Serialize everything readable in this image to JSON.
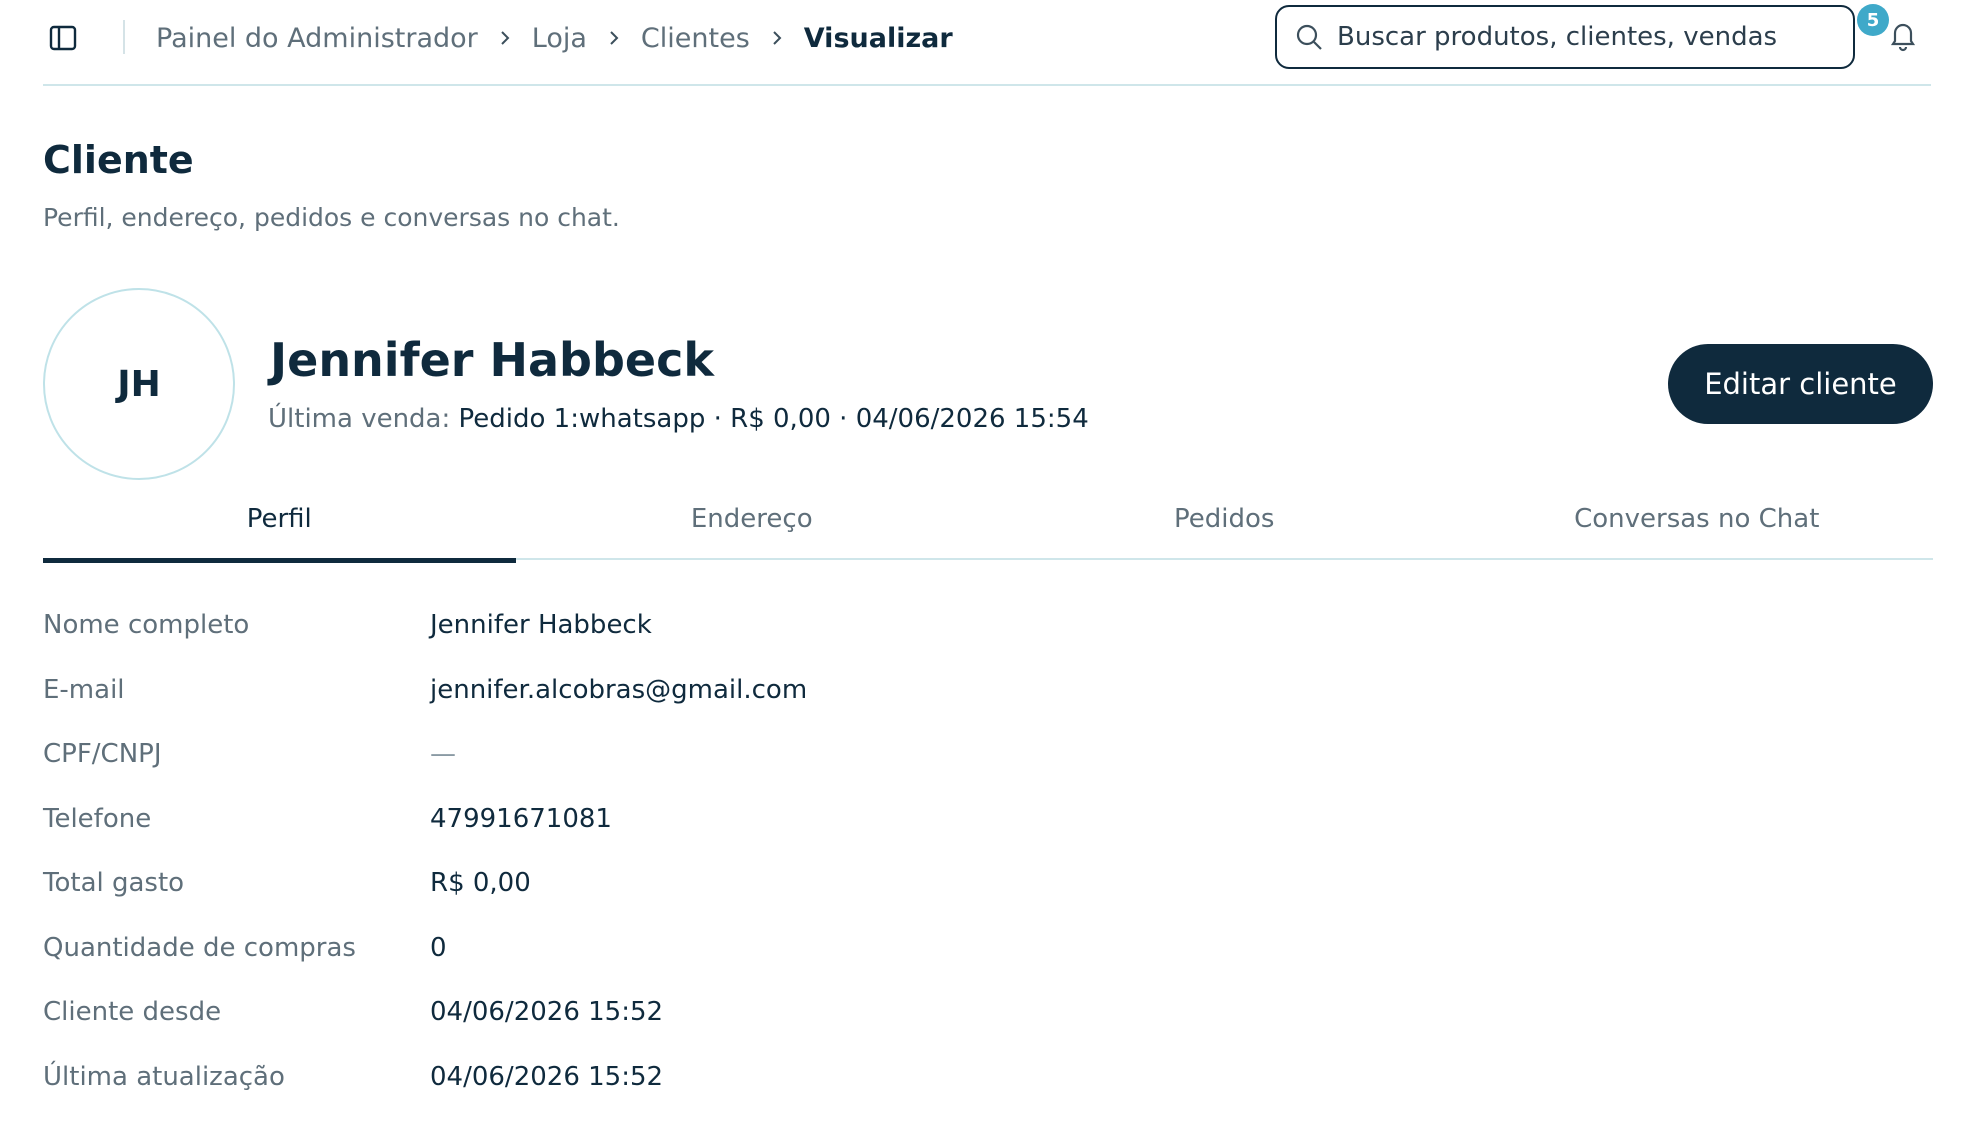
{
  "breadcrumb": {
    "items": [
      "Painel do Administrador",
      "Loja",
      "Clientes"
    ],
    "current": "Visualizar"
  },
  "search": {
    "placeholder": "Buscar produtos, clientes, vendas"
  },
  "notifications": {
    "count": "5"
  },
  "header": {
    "title": "Cliente",
    "subtitle": "Perfil, endereço, pedidos e conversas no chat."
  },
  "customer": {
    "initials": "JH",
    "name": "Jennifer Habbeck",
    "last_sale_label": "Última venda:",
    "last_sale_value": "Pedido 1:whatsapp · R$ 0,00 · 04/06/2026 15:54",
    "edit_label": "Editar cliente"
  },
  "tabs": [
    {
      "label": "Perfil",
      "active": true
    },
    {
      "label": "Endereço",
      "active": false
    },
    {
      "label": "Pedidos",
      "active": false
    },
    {
      "label": "Conversas no Chat",
      "active": false
    }
  ],
  "profile": [
    {
      "label": "Nome completo",
      "value": "Jennifer Habbeck"
    },
    {
      "label": "E-mail",
      "value": "jennifer.alcobras@gmail.com"
    },
    {
      "label": "CPF/CNPJ",
      "value": "—"
    },
    {
      "label": "Telefone",
      "value": "47991671081"
    },
    {
      "label": "Total gasto",
      "value": "R$ 0,00"
    },
    {
      "label": "Quantidade de compras",
      "value": "0"
    },
    {
      "label": "Cliente desde",
      "value": "04/06/2026 15:52"
    },
    {
      "label": "Última atualização",
      "value": "04/06/2026 15:52"
    }
  ],
  "icons": {
    "sidebar": "sidebar-panel-icon",
    "separator": "chevron-right-icon",
    "search": "search-icon",
    "notifications": "bell-icon"
  },
  "colors": {
    "primary": "#0f2a3d",
    "badge": "#3fa9c9",
    "muted": "#5f6f7a",
    "divider": "#cfe6ea"
  }
}
